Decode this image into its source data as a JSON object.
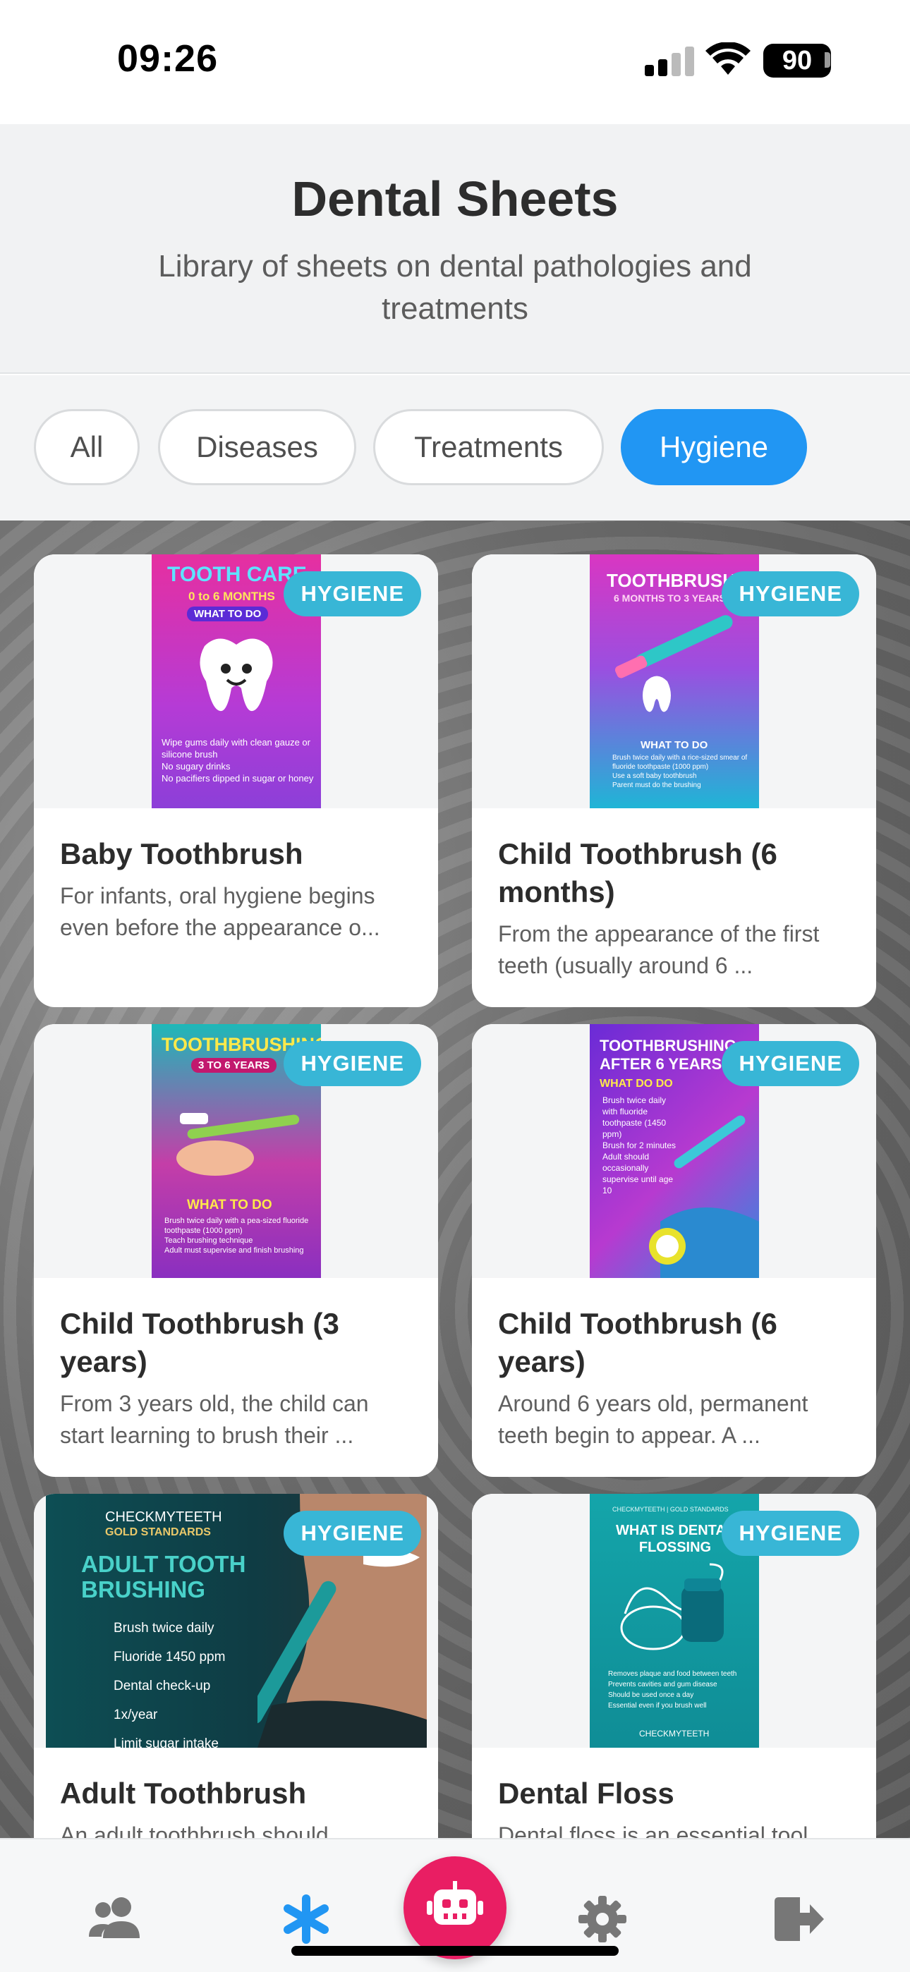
{
  "status_bar": {
    "time": "09:26",
    "battery": "90"
  },
  "header": {
    "title": "Dental Sheets",
    "subtitle": "Library of sheets on dental pathologies and treatments"
  },
  "filters": [
    {
      "label": "All",
      "active": false
    },
    {
      "label": "Diseases",
      "active": false
    },
    {
      "label": "Treatments",
      "active": false
    },
    {
      "label": "Hygiene",
      "active": true
    }
  ],
  "cards": [
    {
      "badge": "HYGIENE",
      "title": "Baby Toothbrush",
      "description": "For infants, oral hygiene begins even before the appearance o...",
      "thumb": {
        "heading": "TOOTH CARE",
        "sub": "0 to 6 MONTHS",
        "tag": "WHAT TO DO",
        "bullets": [
          "Wipe gums daily with clean gauze or silicone brush",
          "No sugary drinks",
          "No pacifiers dipped in sugar or honey"
        ]
      }
    },
    {
      "badge": "HYGIENE",
      "title": "Child Toothbrush (6 months)",
      "description": "From the appearance of the first teeth (usually around 6 ...",
      "thumb": {
        "heading": "TOOTHBRUSHING",
        "sub": "6 MONTHS TO 3 YEARS",
        "tag": "WHAT TO DO",
        "bullets": [
          "Brush twice daily with a rice-sized smear of fluoride toothpaste (1000 ppm)",
          "Use a soft baby toothbrush",
          "Parent must do the brushing"
        ]
      }
    },
    {
      "badge": "HYGIENE",
      "title": "Child Toothbrush (3 years)",
      "description": "From 3 years old, the child can start learning to brush their ...",
      "thumb": {
        "heading": "TOOTHBRUSHING",
        "sub": "3 TO 6 YEARS",
        "tag": "WHAT TO DO",
        "bullets": [
          "Brush twice daily with a pea-sized fluoride toothpaste (1000 ppm)",
          "Teach brushing technique",
          "Adult must supervise and finish brushing"
        ]
      }
    },
    {
      "badge": "HYGIENE",
      "title": "Child Toothbrush (6 years)",
      "description": "Around 6 years old, permanent teeth begin to appear. A ...",
      "thumb": {
        "heading": "TOOTHBRUSHING-",
        "sub": "AFTER 6 YEARS",
        "tag": "WHAT DO DO",
        "bullets": [
          "Brush twice daily with fluoride toothpaste (1450 ppm)",
          "Brush for 2 minutes",
          "Adult should occasionally supervise until age 10"
        ]
      }
    },
    {
      "badge": "HYGIENE",
      "title": "Adult Toothbrush",
      "description": "An adult toothbrush should ...",
      "thumb": {
        "brand": "CHECKMYTEETH",
        "brand_sub": "GOLD STANDARDS",
        "heading": "ADULT TOOTH BRUSHING",
        "bullets": [
          "Brush twice daily",
          "Fluoride 1450 ppm",
          "Dental check-up 1x/year",
          "Limit sugar intake"
        ]
      }
    },
    {
      "badge": "HYGIENE",
      "title": "Dental Floss",
      "description": "Dental floss is an essential tool ...",
      "thumb": {
        "brand": "CHECKMYTEETH | GOLD STANDARDS",
        "heading": "WHAT IS DENTAL FLOSSING",
        "bullets": [
          "Removes plaque and food between teeth",
          "Prevents cavities and gum disease",
          "Should be used once a day",
          "Essential even if you brush well"
        ],
        "footer": "CHECKMYTEETH"
      }
    }
  ],
  "bottom_nav": {
    "items": [
      "people-icon",
      "asterisk-icon",
      "robot-icon",
      "gear-icon",
      "logout-icon"
    ],
    "active": "asterisk-icon",
    "accent": "#2196f3",
    "fab_color": "#e91e63"
  }
}
